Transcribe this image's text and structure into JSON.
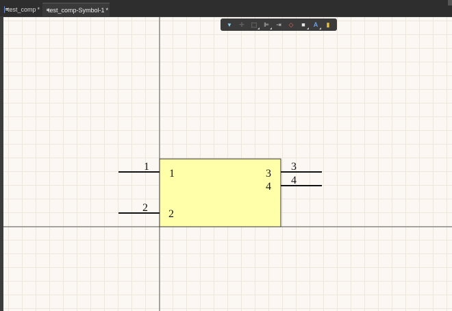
{
  "tabs": [
    {
      "label": "test_comp",
      "modified": "*",
      "icon": "document-icon"
    },
    {
      "label": "test_comp-Symbol-1",
      "modified": "*",
      "icon": "symbol-document-icon"
    }
  ],
  "toolbar": {
    "tools": [
      {
        "name": "filter-icon",
        "glyph": "▼"
      },
      {
        "name": "move-icon",
        "glyph": "✛"
      },
      {
        "name": "select-rect-icon",
        "glyph": "⬚"
      },
      {
        "name": "align-icon",
        "glyph": "⊫"
      },
      {
        "name": "pin-icon",
        "glyph": "⇥"
      },
      {
        "name": "eraser-icon",
        "glyph": "◇"
      },
      {
        "name": "rectangle-icon",
        "glyph": "■"
      },
      {
        "name": "text-icon",
        "glyph": "A"
      },
      {
        "name": "component-icon",
        "glyph": "▮"
      }
    ]
  },
  "symbol": {
    "body_color": "#ffffaa",
    "pins": [
      {
        "outer": "1",
        "inner": "1"
      },
      {
        "outer": "2",
        "inner": "2"
      },
      {
        "outer": "3",
        "inner": "3"
      },
      {
        "outer": "4",
        "inner": "4"
      }
    ]
  }
}
